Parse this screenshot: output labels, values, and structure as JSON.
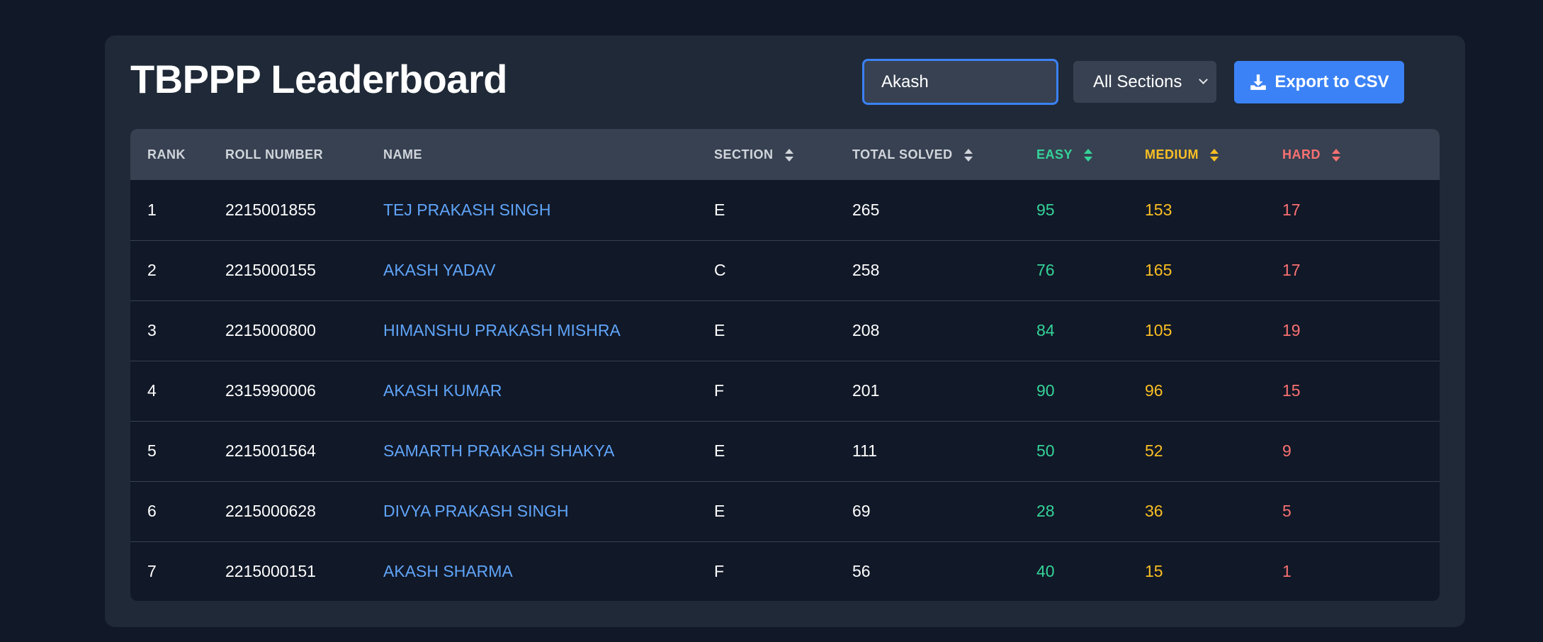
{
  "header": {
    "title": "TBPPP Leaderboard",
    "search_value": "Akash",
    "section_filter": "All Sections",
    "export_label": "Export to CSV"
  },
  "colors": {
    "background": "#111827",
    "card": "#1f2937",
    "accent": "#3b82f6",
    "name_link": "#60a5fa",
    "easy": "#34d399",
    "medium": "#fbbf24",
    "hard": "#f87171"
  },
  "table": {
    "columns": [
      "RANK",
      "ROLL NUMBER",
      "NAME",
      "SECTION",
      "TOTAL SOLVED",
      "EASY",
      "MEDIUM",
      "HARD"
    ],
    "rows": [
      {
        "rank": "1",
        "roll": "2215001855",
        "name": "TEJ PRAKASH SINGH",
        "section": "E",
        "total": "265",
        "easy": "95",
        "medium": "153",
        "hard": "17"
      },
      {
        "rank": "2",
        "roll": "2215000155",
        "name": "AKASH YADAV",
        "section": "C",
        "total": "258",
        "easy": "76",
        "medium": "165",
        "hard": "17"
      },
      {
        "rank": "3",
        "roll": "2215000800",
        "name": "HIMANSHU PRAKASH MISHRA",
        "section": "E",
        "total": "208",
        "easy": "84",
        "medium": "105",
        "hard": "19"
      },
      {
        "rank": "4",
        "roll": "2315990006",
        "name": "AKASH KUMAR",
        "section": "F",
        "total": "201",
        "easy": "90",
        "medium": "96",
        "hard": "15"
      },
      {
        "rank": "5",
        "roll": "2215001564",
        "name": "SAMARTH PRAKASH SHAKYA",
        "section": "E",
        "total": "111",
        "easy": "50",
        "medium": "52",
        "hard": "9"
      },
      {
        "rank": "6",
        "roll": "2215000628",
        "name": "DIVYA PRAKASH SINGH",
        "section": "E",
        "total": "69",
        "easy": "28",
        "medium": "36",
        "hard": "5"
      },
      {
        "rank": "7",
        "roll": "2215000151",
        "name": "AKASH SHARMA",
        "section": "F",
        "total": "56",
        "easy": "40",
        "medium": "15",
        "hard": "1"
      }
    ]
  }
}
